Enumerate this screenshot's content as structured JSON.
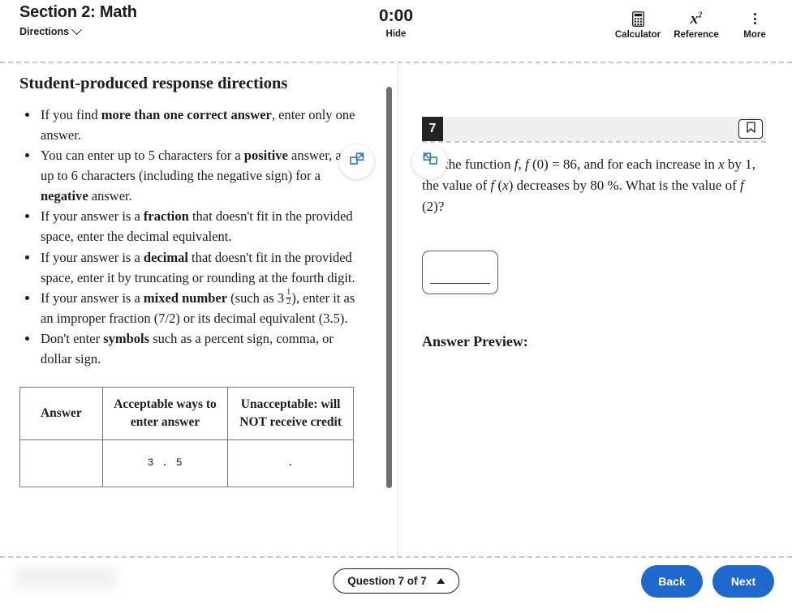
{
  "header": {
    "section_title": "Section 2: Math",
    "directions_label": "Directions",
    "chevron_icon": "chevron-down-icon",
    "timer_value": "0:00",
    "hide_label": "Hide",
    "tools": [
      {
        "label": "Calculator",
        "icon": "calculator-icon"
      },
      {
        "label": "Reference",
        "icon": "x-squared-icon"
      },
      {
        "label": "More",
        "icon": "kebab-menu-icon"
      }
    ]
  },
  "directions_panel": {
    "title": "Student-produced response directions",
    "expand_icon": "expand-panel-icon",
    "bullets": [
      {
        "parts": [
          {
            "t": "If you find "
          },
          {
            "t": "more than one correct answer",
            "b": true
          },
          {
            "t": ", enter only one answer."
          }
        ]
      },
      {
        "parts": [
          {
            "t": "You can enter up to 5 characters for a "
          },
          {
            "t": "positive",
            "b": true
          },
          {
            "t": " answer, and up to 6 characters (including the negative sign) for a "
          },
          {
            "t": "negative",
            "b": true
          },
          {
            "t": " answer."
          }
        ]
      },
      {
        "parts": [
          {
            "t": "If your answer is a "
          },
          {
            "t": "fraction",
            "b": true
          },
          {
            "t": " that doesn't fit in the provided space, enter the decimal equivalent."
          }
        ]
      },
      {
        "parts": [
          {
            "t": "If your answer is a "
          },
          {
            "t": "decimal",
            "b": true
          },
          {
            "t": " that doesn't fit in the provided space, enter it by truncating or rounding at the fourth digit."
          }
        ]
      },
      {
        "parts": [
          {
            "t": "If your answer is a "
          },
          {
            "t": "mixed number",
            "b": true
          },
          {
            "t": " (such as "
          },
          {
            "mixed": {
              "whole": "3",
              "numerator": "1",
              "denominator": "2"
            }
          },
          {
            "t": "), enter it as an improper fraction (7/2) or its decimal equivalent (3.5)."
          }
        ]
      },
      {
        "parts": [
          {
            "t": "Don't enter "
          },
          {
            "t": "symbols",
            "b": true
          },
          {
            "t": " such as a percent sign, comma, or dollar sign."
          }
        ]
      }
    ],
    "table": {
      "headers": [
        "Answer",
        "Acceptable ways to enter answer",
        "Unacceptable: will NOT receive credit"
      ],
      "rows": [
        [
          "",
          "3 . 5",
          "."
        ]
      ]
    }
  },
  "question_panel": {
    "collapse_icon": "collapse-panel-icon",
    "question_number": "7",
    "bookmark_icon": "bookmark-icon",
    "stem_segments": [
      {
        "t": "For the function "
      },
      {
        "t": "f",
        "i": true
      },
      {
        "t": ", "
      },
      {
        "t": "f",
        "i": true
      },
      {
        "t": " (0) = 86",
        "m": true
      },
      {
        "t": ", and for each increase in "
      },
      {
        "t": "x",
        "i": true
      },
      {
        "t": " by "
      },
      {
        "t": "1",
        "m": true
      },
      {
        "t": ", the value of "
      },
      {
        "t": "f",
        "i": true
      },
      {
        "t": " (",
        "m": true
      },
      {
        "t": "x",
        "i": true
      },
      {
        "t": ")",
        "m": true
      },
      {
        "t": " decreases by "
      },
      {
        "t": "80 %",
        "m": true
      },
      {
        "t": ". What is the value of "
      },
      {
        "t": "f",
        "i": true
      },
      {
        "t": " (2)",
        "m": true
      },
      {
        "t": "?"
      }
    ],
    "answer_input_value": "",
    "answer_input_placeholder": "",
    "answer_preview_label": "Answer Preview:"
  },
  "footer": {
    "question_select_label": "Question 7 of 7",
    "caret_icon": "caret-up-icon",
    "back_label": "Back",
    "next_label": "Next"
  },
  "colors": {
    "accent_blue": "#2069cc",
    "icon_blue": "#3d7ab5",
    "badge_dark": "#232323",
    "qbar_gray": "#efefef"
  }
}
